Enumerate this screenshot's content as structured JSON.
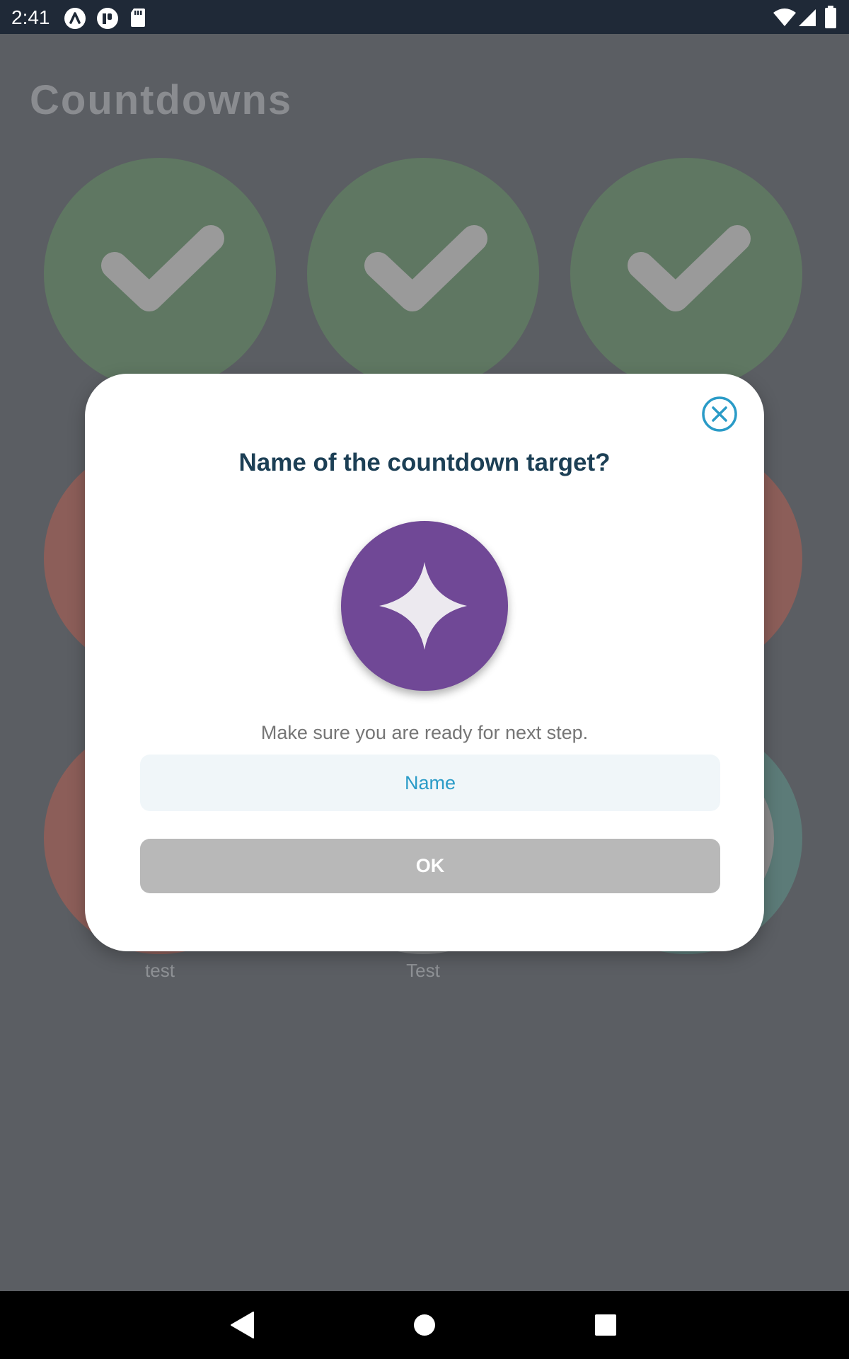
{
  "status_bar": {
    "time": "2:41",
    "left_icons": [
      "app-a-icon",
      "app-p-icon",
      "sd-card-icon"
    ],
    "right_icons": [
      "wifi-icon",
      "signal-icon",
      "battery-icon"
    ]
  },
  "background": {
    "title": "Countdowns",
    "items": [
      {
        "state": "completed",
        "color": "#5f7762"
      },
      {
        "state": "completed",
        "color": "#5f7762"
      },
      {
        "state": "completed",
        "color": "#5f7762"
      },
      {
        "state": "active",
        "color": "#8c5e59"
      },
      {
        "state": "hidden",
        "color": ""
      },
      {
        "state": "active",
        "color": "#8c5e59"
      },
      {
        "state": "active",
        "color": "#8c5e59",
        "label": "test"
      },
      {
        "state": "active",
        "color": "",
        "label": "Test"
      },
      {
        "state": "active",
        "color": "#5c7b78"
      }
    ]
  },
  "dialog": {
    "title": "Name of the countdown target?",
    "icon": "sparkle-icon",
    "subtitle": "Make sure you are ready for next step.",
    "name_input": {
      "placeholder": "Name",
      "value": ""
    },
    "ok_label": "OK",
    "colors": {
      "accent": "#2a9bc7",
      "title": "#1c3f55",
      "avatar": "#704896",
      "button_disabled": "#b8b8b8"
    }
  },
  "nav_bar": {
    "buttons": [
      "back-icon",
      "home-icon",
      "recents-icon"
    ]
  }
}
